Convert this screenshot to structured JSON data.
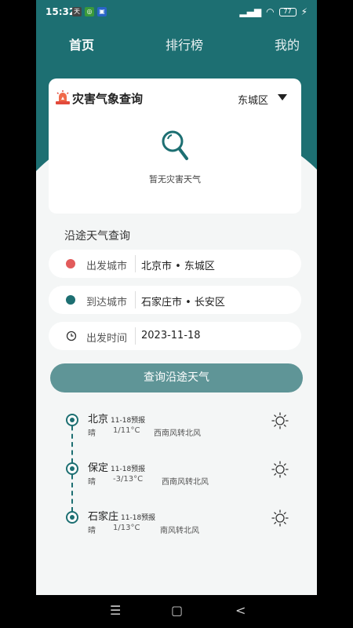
{
  "status": {
    "time": "15:32",
    "battery": "77"
  },
  "nav": {
    "home": "首页",
    "ranking": "排行榜",
    "mine": "我的"
  },
  "disaster": {
    "title": "灾害气象查询",
    "district": "东城区",
    "empty": "暂无灾害天气"
  },
  "route": {
    "title": "沿途天气查询",
    "depart_label": "出发城市",
    "depart_value": "北京市 • 东城区",
    "arrive_label": "到达城市",
    "arrive_value": "石家庄市 • 长安区",
    "time_label": "出发时间",
    "time_value": "2023-11-18",
    "button": "查询沿途天气"
  },
  "stops": [
    {
      "name": "北京",
      "tag": "11-18预报",
      "weather": "晴",
      "temp": "1/11°C",
      "wind": "西南风转北风"
    },
    {
      "name": "保定",
      "tag": "11-18预报",
      "weather": "晴",
      "temp": "-3/13°C",
      "wind": "西南风转北风"
    },
    {
      "name": "石家庄",
      "tag": "11-18预报",
      "weather": "晴",
      "temp": "1/13°C",
      "wind": "南风转北风"
    }
  ],
  "colors": {
    "primary": "#1d6f72",
    "button": "#5f9597",
    "depart_dot": "#e25b5b",
    "arrive_dot": "#1d6f72"
  },
  "icons": [
    "warning-icon",
    "search-icon",
    "clock-icon",
    "sun-icon",
    "menu-icon",
    "home-square-icon",
    "back-icon"
  ]
}
